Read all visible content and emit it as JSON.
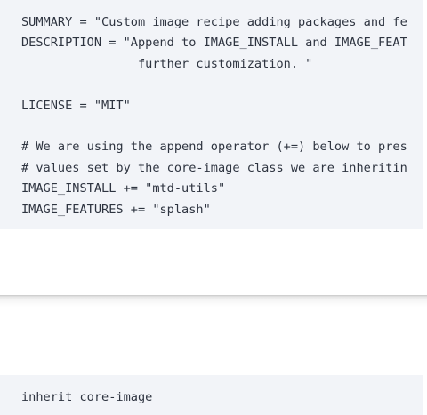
{
  "code_block_top": {
    "lines": [
      "SUMMARY = \"Custom image recipe adding packages and fe",
      "DESCRIPTION = \"Append to IMAGE_INSTALL and IMAGE_FEAT",
      "                further customization. \"",
      "",
      "LICENSE = \"MIT\"",
      "",
      "# We are using the append operator (+=) below to pres",
      "# values set by the core-image class we are inheritin",
      "IMAGE_INSTALL += \"mtd-utils\"",
      "IMAGE_FEATURES += \"splash\""
    ]
  },
  "code_block_bottom": {
    "lines": [
      "inherit core-image"
    ]
  }
}
